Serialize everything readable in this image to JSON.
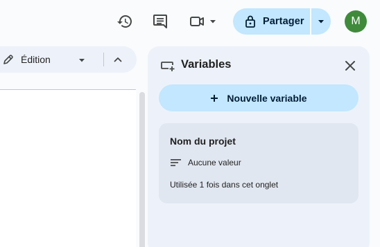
{
  "header": {
    "history_icon": "history-icon",
    "comment_icon": "comment-icon",
    "meet_icon": "video-camera-icon",
    "share": {
      "label": "Partager",
      "icon": "lock-icon",
      "more_icon": "caret-down-icon"
    },
    "avatar_initial": "M",
    "avatar_color": "#3f8b3b"
  },
  "mode_toolbar": {
    "label": "Édition",
    "icon": "pencil-icon",
    "collapse_icon": "chevron-up-icon"
  },
  "panel": {
    "title": "Variables",
    "icon": "variable-insert-icon",
    "close_icon": "close-icon",
    "new_variable_label": "Nouvelle variable",
    "variables": [
      {
        "name": "Nom du projet",
        "value": "Aucune valeur",
        "usage": "Utilisée 1 fois dans cet onglet"
      }
    ]
  },
  "colors": {
    "accent": "#c2e7ff",
    "panel_bg": "#edf2fa",
    "card_bg": "#e1e7f0",
    "page_bg": "#f9fbfd"
  }
}
